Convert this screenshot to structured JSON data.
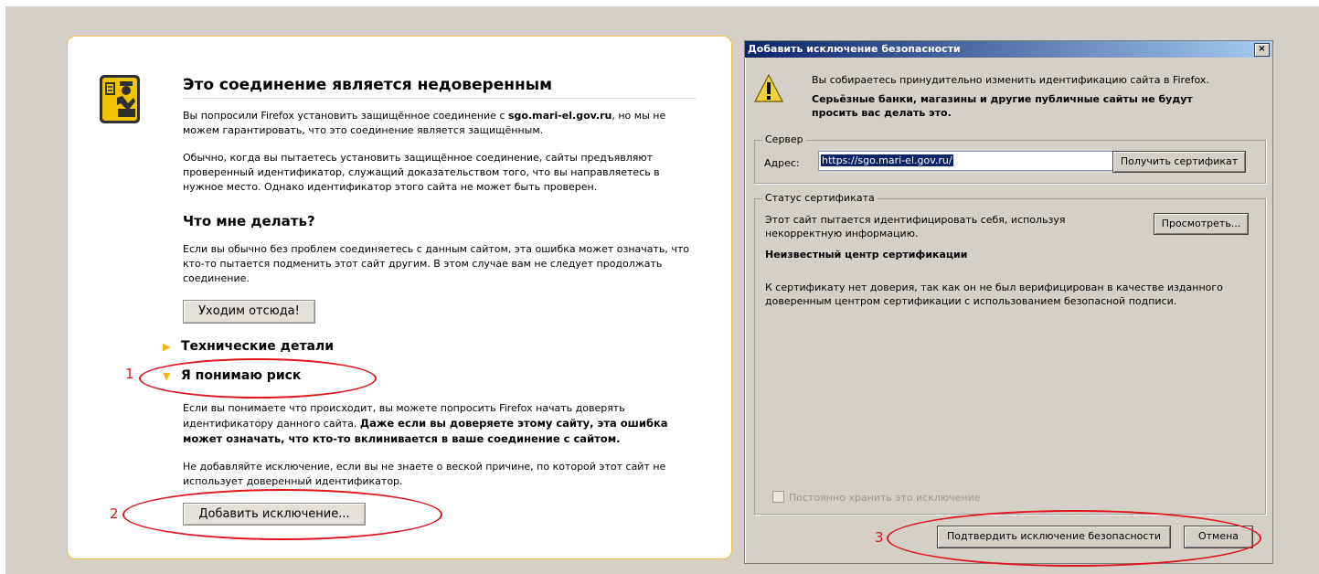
{
  "error_page": {
    "title": "Это соединение является недоверенным",
    "intro_prefix": "Вы попросили Firefox установить защищённое соединение с ",
    "intro_host": "sgo.mari-el.gov.ru",
    "intro_suffix": ", но мы не можем гарантировать, что это соединение является защищённым.",
    "para2": "Обычно, когда вы пытаетесь установить защищённое соединение, сайты предъявляют проверенный идентификатор, служащий доказательством того, что вы направляетесь в нужное место. Однако идентификатор этого сайта не может быть проверен.",
    "what_heading": "Что мне делать?",
    "what_text": "Если вы обычно без проблем соединяетесь с данным сайтом, эта ошибка может означать, что кто-то пытается подменить этот сайт другим. В этом случае вам не следует продолжать соединение.",
    "get_out_button": "Уходим отсюда!",
    "tech_details": "Технические детали",
    "understand_risk": "Я понимаю риск",
    "risk_text_plain": "Если вы понимаете что происходит, вы можете попросить Firefox начать доверять идентификатору данного сайта. ",
    "risk_text_bold": "Даже если вы доверяете этому сайту, эта ошибка может означать, что кто-то вклинивается в ваше соединение с сайтом.",
    "no_add_text": "Не добавляйте исключение, если вы не знаете о веской причине, по которой этот сайт не использует доверенный идентификатор.",
    "add_exception_button": "Добавить исключение..."
  },
  "annotations": [
    "1",
    "2",
    "3"
  ],
  "dialog": {
    "title": "Добавить исключение безопасности",
    "close_glyph": "×",
    "warn_line1": "Вы собираетесь принудительно изменить идентификацию сайта в Firefox.",
    "warn_bold": "Серьёзные банки, магазины и другие публичные сайты не будут просить вас делать это.",
    "server_group": "Сервер",
    "address_label": "Адрес:",
    "address_value": "https://sgo.mari-el.gov.ru/",
    "get_cert_button": "Получить сертификат",
    "status_group": "Статус сертификата",
    "status_text": "Этот сайт пытается идентифицировать себя, используя некорректную информацию.",
    "view_button": "Просмотреть...",
    "unknown_ca": "Неизвестный центр сертификации",
    "ca_text": "К сертификату нет доверия, так как он не был верифицирован в качестве изданного доверенным центром сертификации с использованием безопасной подписи.",
    "permanent_checkbox": "Постоянно хранить это исключение",
    "confirm_button": "Подтвердить исключение безопасности",
    "cancel_button": "Отмена"
  },
  "colors": {
    "desktop": "#d4d0c8",
    "page_border": "#f0c14a",
    "annotation": "#e0141e",
    "titlebar_start": "#0a246a",
    "titlebar_end": "#a6caf0"
  }
}
